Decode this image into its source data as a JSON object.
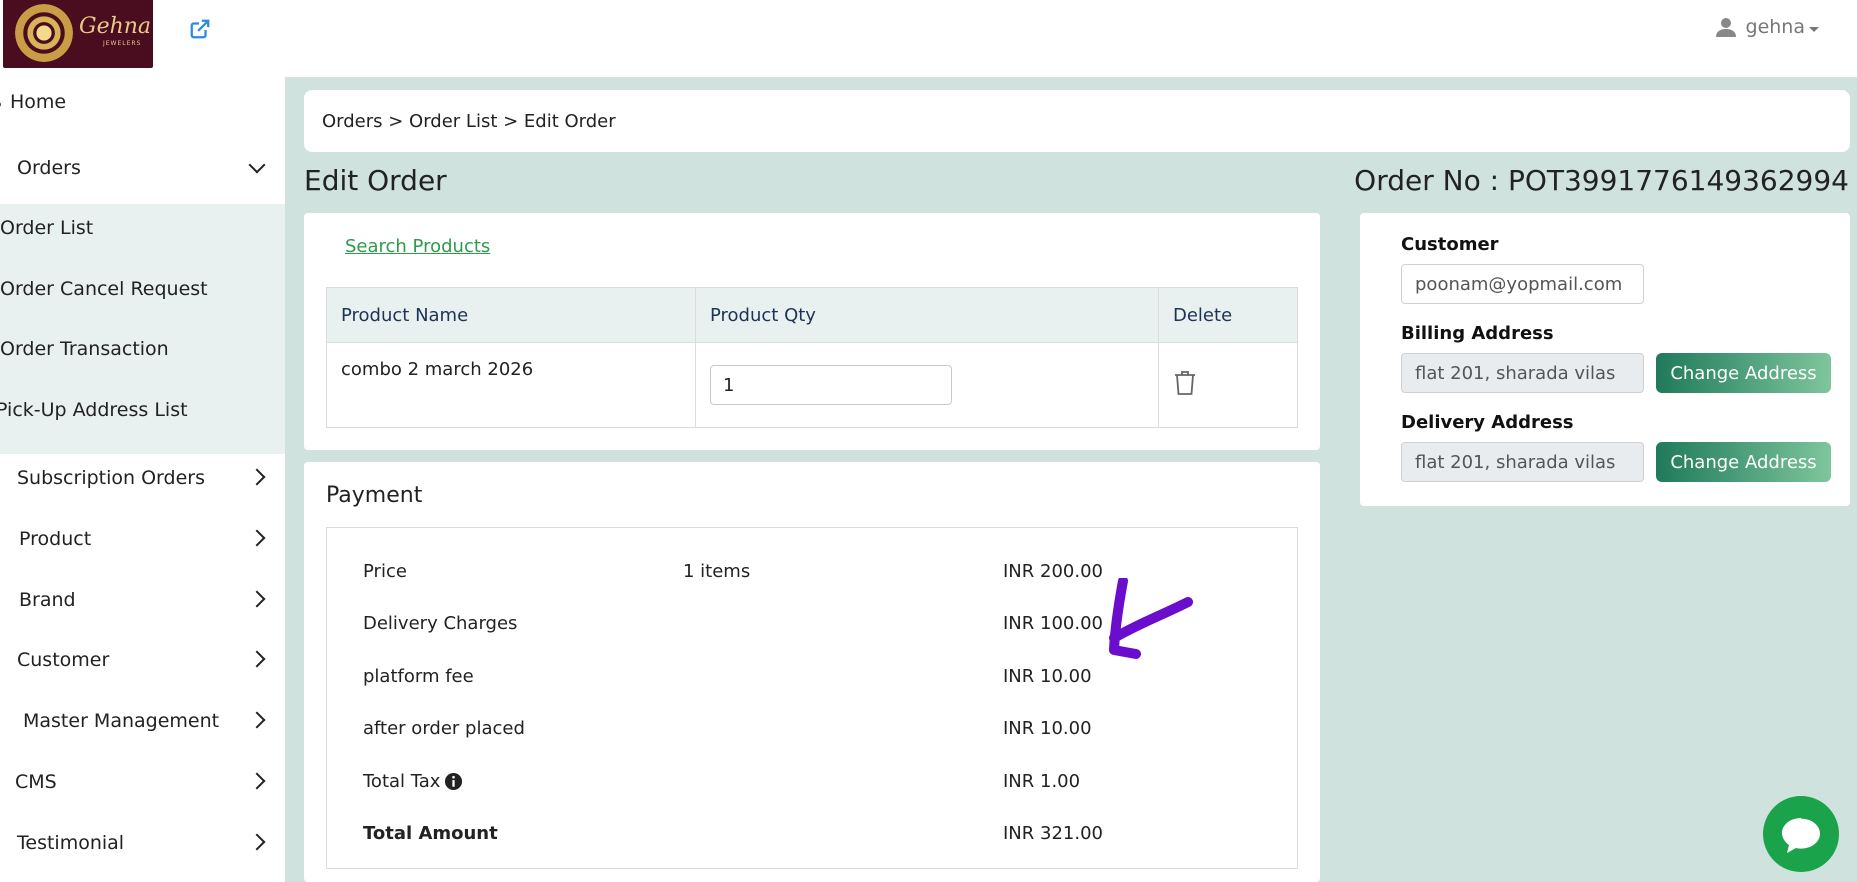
{
  "header": {
    "brand_name": "Gehna",
    "brand_sub": "JEWELERS",
    "user_name": "gehna"
  },
  "sidebar": {
    "home": "Home",
    "orders": "Orders",
    "order_list": "Order List",
    "order_cancel": "Order Cancel Request",
    "order_txn": "Order Transaction",
    "pickup": "Pick-Up Address List",
    "subscription": "Subscription Orders",
    "product": "Product",
    "brand": "Brand",
    "customer": "Customer",
    "master": "Master Management",
    "cms": "CMS",
    "testimonial": "Testimonial"
  },
  "breadcrumb": "Orders > Order List > Edit Order",
  "page": {
    "title": "Edit Order",
    "order_no": "Order No : POT3991776149362994"
  },
  "products": {
    "search_link": "Search Products",
    "columns": [
      "Product Name",
      "Product Qty",
      "Delete"
    ],
    "rows": [
      {
        "name": "combo 2 march 2026",
        "qty": "1"
      }
    ]
  },
  "payment": {
    "title": "Payment",
    "rows": [
      {
        "label": "Price",
        "middle": "1 items",
        "value": "INR 200.00"
      },
      {
        "label": "Delivery Charges",
        "middle": "",
        "value": "INR 100.00"
      },
      {
        "label": "platform fee",
        "middle": "",
        "value": "INR 10.00"
      },
      {
        "label": "after order placed",
        "middle": "",
        "value": "INR 10.00"
      },
      {
        "label": "Total Tax",
        "middle": "",
        "value": "INR 1.00"
      },
      {
        "label": "Total Amount",
        "middle": "",
        "value": "INR 321.00"
      }
    ]
  },
  "customer_panel": {
    "customer_label": "Customer",
    "customer_email": "poonam@yopmail.com",
    "billing_label": "Billing Address",
    "billing_value": "flat 201, sharada vilas",
    "delivery_label": "Delivery Address",
    "delivery_value": "flat 201, sharada vilas",
    "change_btn": "Change Address"
  },
  "colors": {
    "accent_green": "#2e9b4a",
    "page_bg": "#cfe2dd",
    "annotation": "#6a0dcc"
  }
}
